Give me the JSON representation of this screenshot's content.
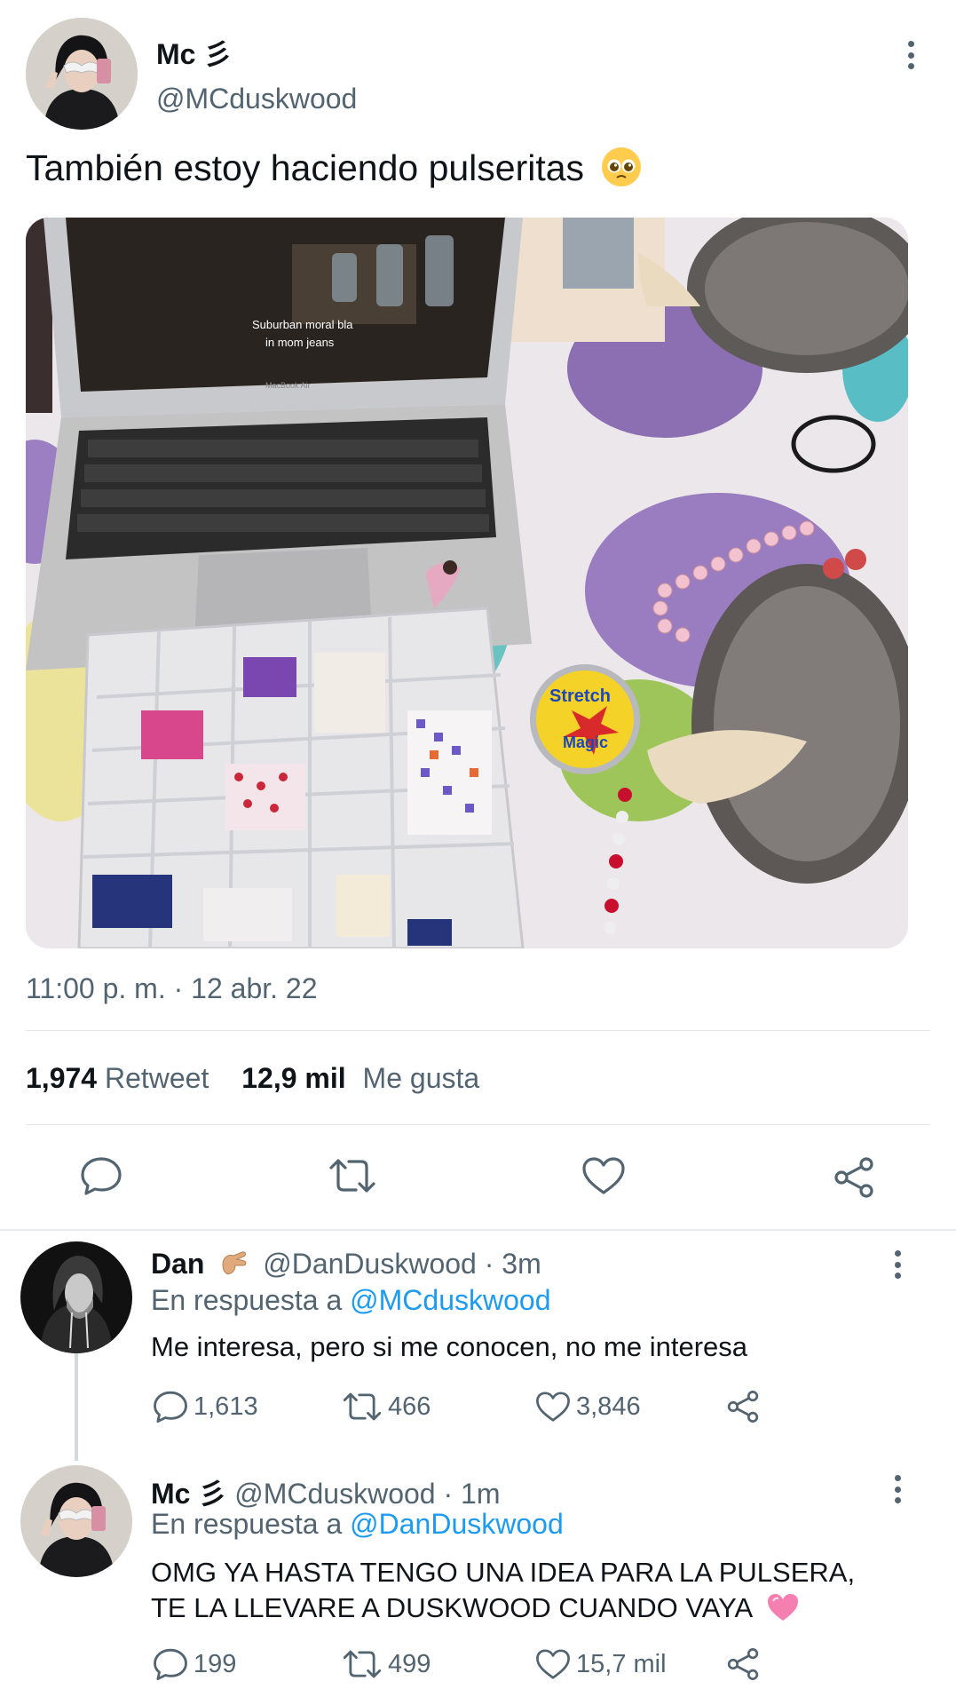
{
  "main_tweet": {
    "display_name": "Mc 彡",
    "handle": "@MCduskwood",
    "text": "También estoy haciendo pulseritas",
    "emoji": "pleading-face",
    "photo_texts": {
      "subtitle_1": "Suburban moral bla",
      "subtitle_2": "in mom jeans",
      "laptop_brand": "MacBook Air",
      "spool_label_1": "Stretch",
      "spool_label_2": "Magic"
    },
    "timestamp": "11:00 p. m. · 12 abr. 22",
    "retweet_count": "1,974",
    "retweet_label": "Retweet",
    "like_count": "12,9 mil",
    "like_label": "Me gusta",
    "actions": [
      "reply-icon",
      "retweet-icon",
      "like-icon",
      "share-icon"
    ]
  },
  "replies": [
    {
      "display_name": "Dan",
      "emoji": "pinching-hand-emoji",
      "handle": "@DanDuskwood",
      "time": "· 3m",
      "reply_prefix": "En respuesta a",
      "reply_to": "@MCduskwood",
      "text": "Me interesa, pero si me conocen, no me interesa",
      "replies": "1,613",
      "retweets": "466",
      "likes": "3,846"
    },
    {
      "display_name": "Mc 彡",
      "handle": "@MCduskwood",
      "time": "· 1m",
      "reply_prefix": "En respuesta a",
      "reply_to": "@DanDuskwood",
      "text_line1": "OMG YA HASTA TENGO UNA IDEA PARA LA PULSERA,",
      "text_line2": "TE LA LLEVARE A DUSKWOOD CUANDO VAYA",
      "emoji": "pink-heart-emoji",
      "replies": "199",
      "retweets": "499",
      "likes": "15,7 mil"
    }
  ],
  "colors": {
    "text": "#0f1419",
    "secondary": "#536471",
    "link": "#1d9bf0",
    "divider": "#e1e5e8"
  }
}
